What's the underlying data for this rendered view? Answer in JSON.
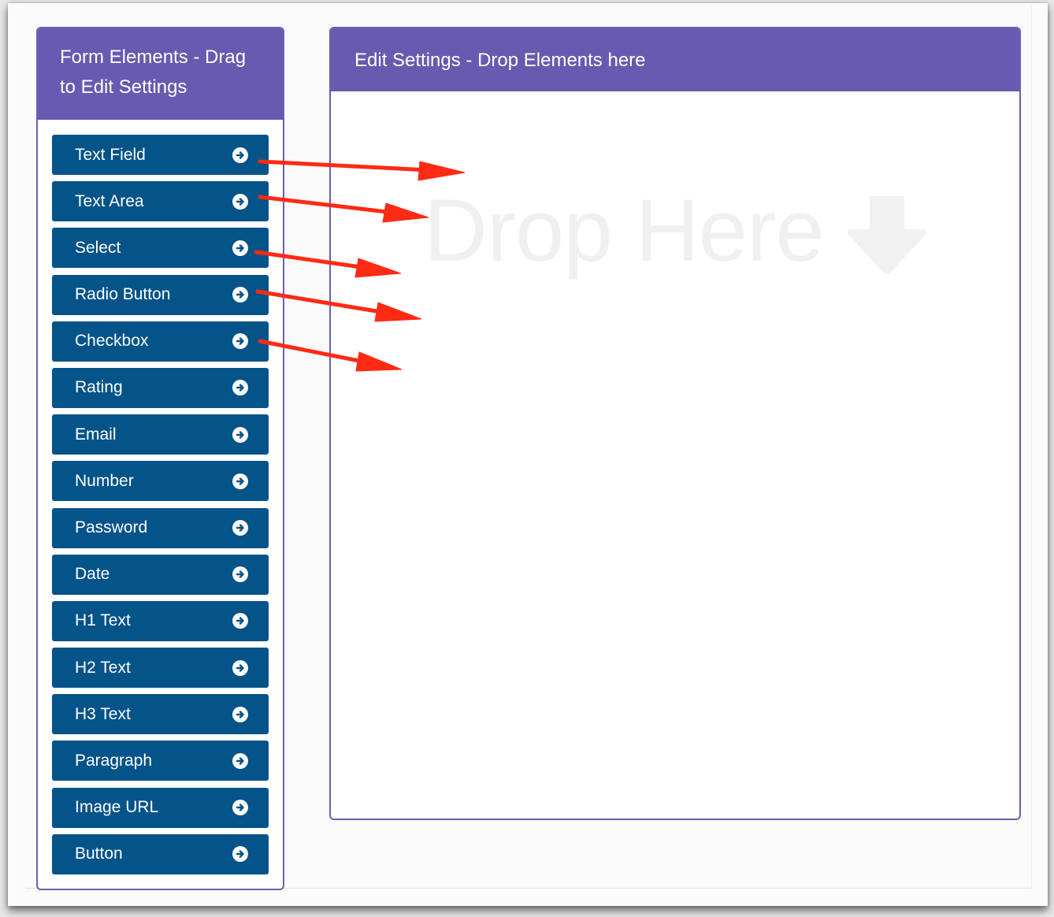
{
  "left_panel": {
    "title_line1": "Form Elements - Drag",
    "title_line2": "to Edit Settings",
    "items": [
      {
        "label": "Text Field"
      },
      {
        "label": "Text Area"
      },
      {
        "label": "Select"
      },
      {
        "label": "Radio Button"
      },
      {
        "label": "Checkbox"
      },
      {
        "label": "Rating"
      },
      {
        "label": "Email"
      },
      {
        "label": "Number"
      },
      {
        "label": "Password"
      },
      {
        "label": "Date"
      },
      {
        "label": "H1 Text"
      },
      {
        "label": "H2 Text"
      },
      {
        "label": "H3 Text"
      },
      {
        "label": "Paragraph"
      },
      {
        "label": "Image URL"
      },
      {
        "label": "Button"
      }
    ],
    "item_icon": "arrow-circle-right-icon"
  },
  "right_panel": {
    "title": "Edit Settings - Drop Elements here",
    "drop_placeholder": "Drop Here",
    "drop_icon": "arrow-down-icon"
  },
  "colors": {
    "header": "#675ab0",
    "button": "#045389",
    "annotation_arrow": "#ff2a14"
  }
}
